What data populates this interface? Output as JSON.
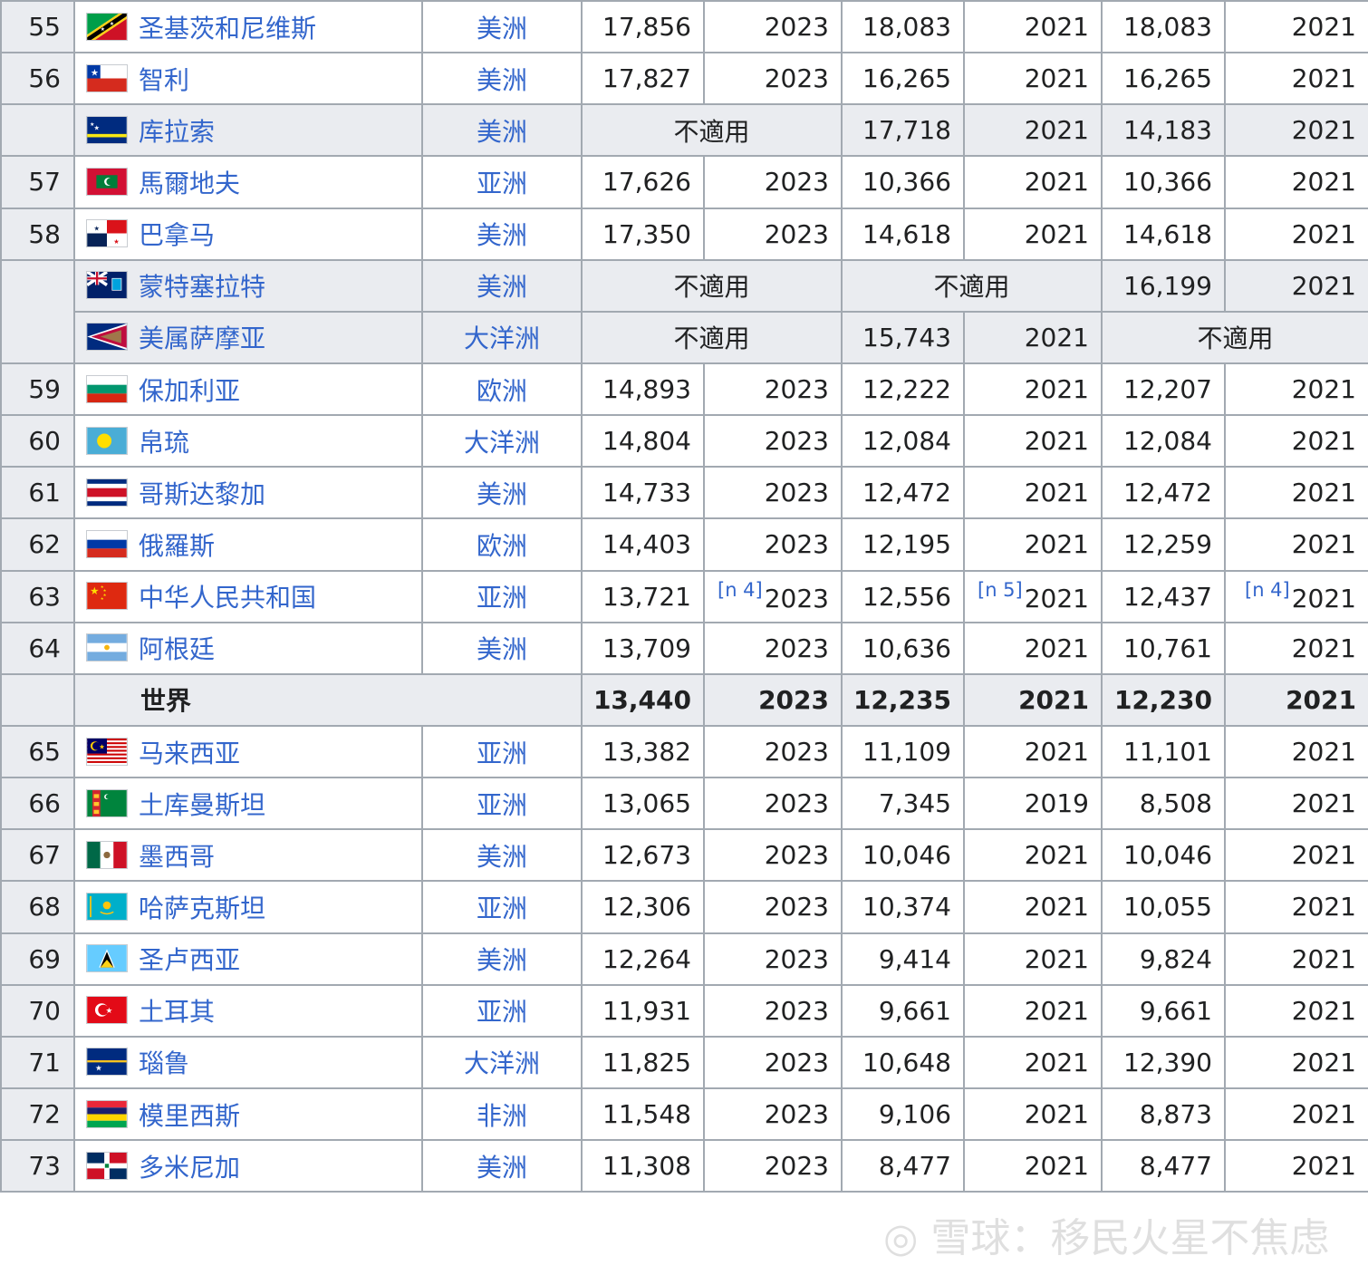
{
  "labels": {
    "not_applicable": "不適用"
  },
  "rows": {
    "r55": {
      "rank": "55",
      "country": "圣基茨和尼维斯",
      "flag": "kitts-flag",
      "continent": "美洲",
      "a": "17,856",
      "ay": "2023",
      "b": "18,083",
      "by": "2021",
      "c": "18,083",
      "cy": "2021"
    },
    "r56": {
      "rank": "56",
      "country": "智利",
      "flag": "chile-flag",
      "continent": "美洲",
      "a": "17,827",
      "ay": "2023",
      "b": "16,265",
      "by": "2021",
      "c": "16,265",
      "cy": "2021"
    },
    "curacao": {
      "country": "库拉索",
      "flag": "curacao-flag",
      "continent": "美洲",
      "b": "17,718",
      "by": "2021",
      "c": "14,183",
      "cy": "2021"
    },
    "r57": {
      "rank": "57",
      "country": "馬爾地夫",
      "flag": "maldives-flag",
      "continent": "亚洲",
      "a": "17,626",
      "ay": "2023",
      "b": "10,366",
      "by": "2021",
      "c": "10,366",
      "cy": "2021"
    },
    "r58": {
      "rank": "58",
      "country": "巴拿马",
      "flag": "panama-flag",
      "continent": "美洲",
      "a": "17,350",
      "ay": "2023",
      "b": "14,618",
      "by": "2021",
      "c": "14,618",
      "cy": "2021"
    },
    "montserrat": {
      "country": "蒙特塞拉特",
      "flag": "montserrat-flag",
      "continent": "美洲",
      "c": "16,199",
      "cy": "2021"
    },
    "samoa": {
      "country": "美属萨摩亚",
      "flag": "american-samoa-flag",
      "continent": "大洋洲",
      "b": "15,743",
      "by": "2021"
    },
    "r59": {
      "rank": "59",
      "country": "保加利亚",
      "flag": "bulgaria-flag",
      "continent": "欧洲",
      "a": "14,893",
      "ay": "2023",
      "b": "12,222",
      "by": "2021",
      "c": "12,207",
      "cy": "2021"
    },
    "r60": {
      "rank": "60",
      "country": "帛琉",
      "flag": "palau-flag",
      "continent": "大洋洲",
      "a": "14,804",
      "ay": "2023",
      "b": "12,084",
      "by": "2021",
      "c": "12,084",
      "cy": "2021"
    },
    "r61": {
      "rank": "61",
      "country": "哥斯达黎加",
      "flag": "costa-rica-flag",
      "continent": "美洲",
      "a": "14,733",
      "ay": "2023",
      "b": "12,472",
      "by": "2021",
      "c": "12,472",
      "cy": "2021"
    },
    "r62": {
      "rank": "62",
      "country": "俄羅斯",
      "flag": "russia-flag",
      "continent": "欧洲",
      "a": "14,403",
      "ay": "2023",
      "b": "12,195",
      "by": "2021",
      "c": "12,259",
      "cy": "2021"
    },
    "r63": {
      "rank": "63",
      "country": "中华人民共和国",
      "flag": "china-flag",
      "continent": "亚洲",
      "a": "13,721",
      "ay": "2023",
      "b": "12,556",
      "by": "2021",
      "c": "12,437",
      "cy": "2021",
      "a_note": "[n 4]",
      "b_note": "[n 5]",
      "c_note": "[n 4]"
    },
    "r64": {
      "rank": "64",
      "country": "阿根廷",
      "flag": "argentina-flag",
      "continent": "美洲",
      "a": "13,709",
      "ay": "2023",
      "b": "10,636",
      "by": "2021",
      "c": "10,761",
      "cy": "2021"
    },
    "world": {
      "country": "世界",
      "a": "13,440",
      "ay": "2023",
      "b": "12,235",
      "by": "2021",
      "c": "12,230",
      "cy": "2021"
    },
    "r65": {
      "rank": "65",
      "country": "马来西亚",
      "flag": "malaysia-flag",
      "continent": "亚洲",
      "a": "13,382",
      "ay": "2023",
      "b": "11,109",
      "by": "2021",
      "c": "11,101",
      "cy": "2021"
    },
    "r66": {
      "rank": "66",
      "country": "土库曼斯坦",
      "flag": "turkmenistan-flag",
      "continent": "亚洲",
      "a": "13,065",
      "ay": "2023",
      "b": "7,345",
      "by": "2019",
      "c": "8,508",
      "cy": "2021"
    },
    "r67": {
      "rank": "67",
      "country": "墨西哥",
      "flag": "mexico-flag",
      "continent": "美洲",
      "a": "12,673",
      "ay": "2023",
      "b": "10,046",
      "by": "2021",
      "c": "10,046",
      "cy": "2021"
    },
    "r68": {
      "rank": "68",
      "country": "哈萨克斯坦",
      "flag": "kazakhstan-flag",
      "continent": "亚洲",
      "a": "12,306",
      "ay": "2023",
      "b": "10,374",
      "by": "2021",
      "c": "10,055",
      "cy": "2021"
    },
    "r69": {
      "rank": "69",
      "country": "圣卢西亚",
      "flag": "saint-lucia-flag",
      "continent": "美洲",
      "a": "12,264",
      "ay": "2023",
      "b": "9,414",
      "by": "2021",
      "c": "9,824",
      "cy": "2021"
    },
    "r70": {
      "rank": "70",
      "country": "土耳其",
      "flag": "turkey-flag",
      "continent": "亚洲",
      "a": "11,931",
      "ay": "2023",
      "b": "9,661",
      "by": "2021",
      "c": "9,661",
      "cy": "2021"
    },
    "r71": {
      "rank": "71",
      "country": "瑙鲁",
      "flag": "nauru-flag",
      "continent": "大洋洲",
      "a": "11,825",
      "ay": "2023",
      "b": "10,648",
      "by": "2021",
      "c": "12,390",
      "cy": "2021"
    },
    "r72": {
      "rank": "72",
      "country": "模里西斯",
      "flag": "mauritius-flag",
      "continent": "非洲",
      "a": "11,548",
      "ay": "2023",
      "b": "9,106",
      "by": "2021",
      "c": "8,873",
      "cy": "2021"
    },
    "r73": {
      "rank": "73",
      "country": "多米尼加",
      "flag": "dominican-republic-flag",
      "continent": "美洲",
      "a": "11,308",
      "ay": "2023",
      "b": "8,477",
      "by": "2021",
      "c": "8,477",
      "cy": "2021"
    }
  },
  "watermark": "雪球：移民火星不焦虑"
}
